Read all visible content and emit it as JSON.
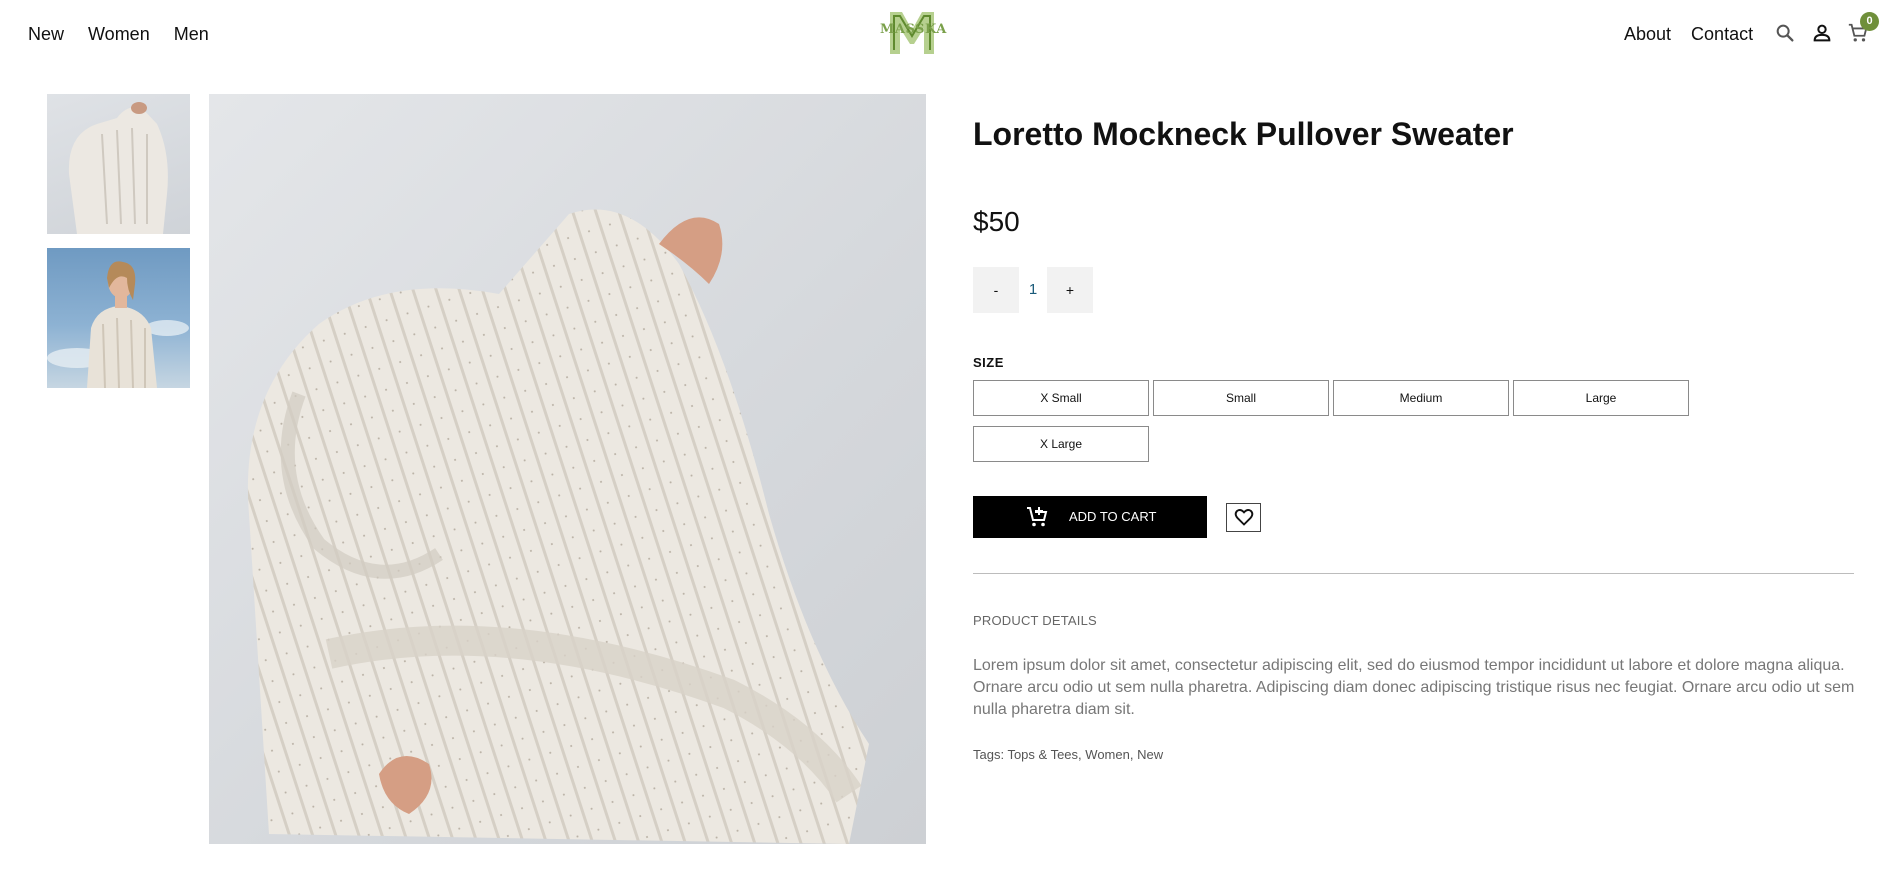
{
  "header": {
    "nav_left": [
      "New",
      "Women",
      "Men"
    ],
    "logo_text": "MASSKA",
    "nav_right": [
      "About",
      "Contact"
    ],
    "cart_count": "0",
    "accent_color": "#6f8f3a"
  },
  "icons": {
    "search": "search-icon",
    "account": "user-icon",
    "cart": "cart-icon",
    "add_to_cart": "add-cart-icon",
    "wishlist": "heart-icon"
  },
  "gallery": {
    "thumbnails": [
      "sweater-front",
      "sweater-model-sky"
    ],
    "main_image": "sweater-front"
  },
  "product": {
    "title": "Loretto Mockneck Pullover Sweater",
    "price": "$50",
    "quantity": {
      "minus": "-",
      "value": "1",
      "plus": "+"
    },
    "size_label": "SIZE",
    "sizes": [
      "X Small",
      "Small",
      "Medium",
      "Large",
      "X Large"
    ],
    "add_to_cart_label": "ADD TO CART",
    "details_heading": "PRODUCT DETAILS",
    "details_text": "Lorem ipsum dolor sit amet, consectetur adipiscing elit, sed do eiusmod tempor incididunt ut labore et dolore magna aliqua. Ornare arcu odio ut sem nulla pharetra. Adipiscing diam donec adipiscing tristique risus nec feugiat. Ornare arcu odio ut sem nulla pharetra diam sit.",
    "tags_label": "Tags: ",
    "tags": [
      "Tops & Tees",
      "Women",
      "New"
    ],
    "tag_separator": ", "
  }
}
